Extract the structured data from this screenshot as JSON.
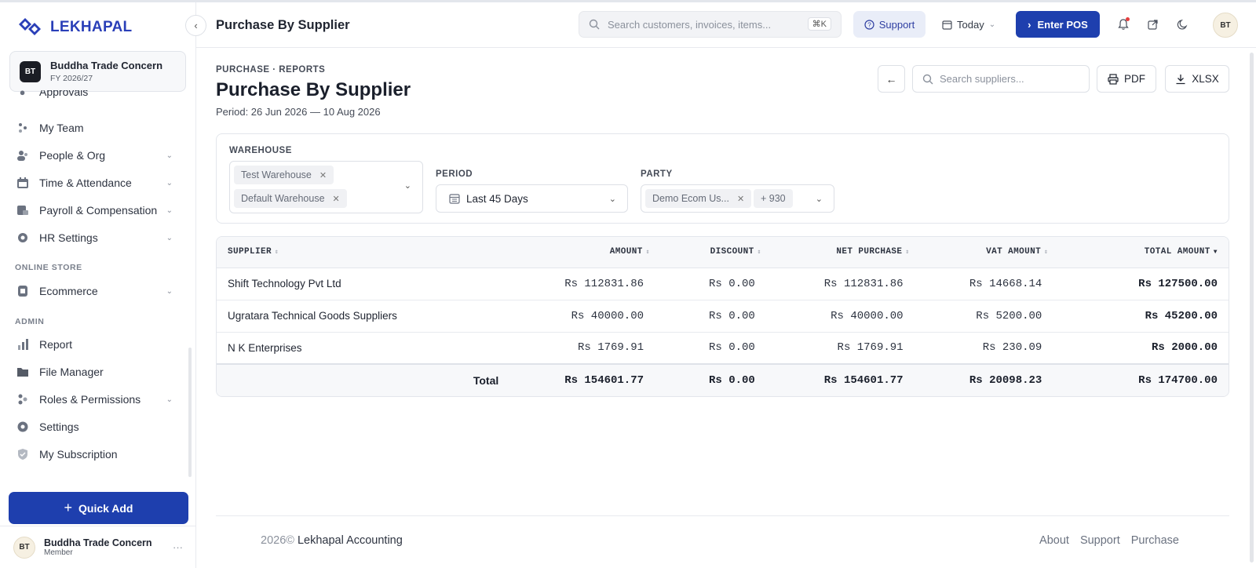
{
  "brand": {
    "name": "LEKHAPAL",
    "accent": "#1e3fae"
  },
  "company": {
    "initials": "BT",
    "name": "Buddha Trade Concern",
    "fy": "FY 2026/27"
  },
  "sidebar": {
    "partial_item": "Approvals",
    "items": [
      {
        "label": "My Team",
        "icon": "team-icon",
        "expandable": false
      },
      {
        "label": "People & Org",
        "icon": "people-icon",
        "expandable": true
      },
      {
        "label": "Time & Attendance",
        "icon": "calendar-icon",
        "expandable": true
      },
      {
        "label": "Payroll & Compensation",
        "icon": "payroll-icon",
        "expandable": true
      },
      {
        "label": "HR Settings",
        "icon": "gear-icon",
        "expandable": true
      }
    ],
    "section_online_store": "ONLINE STORE",
    "ecommerce": "Ecommerce",
    "section_admin": "ADMIN",
    "admin_items": [
      {
        "label": "Report",
        "icon": "bar-chart-icon",
        "expandable": false
      },
      {
        "label": "File Manager",
        "icon": "folder-icon",
        "expandable": false
      },
      {
        "label": "Roles & Permissions",
        "icon": "roles-icon",
        "expandable": true
      },
      {
        "label": "Settings",
        "icon": "settings-icon",
        "expandable": false
      },
      {
        "label": "My Subscription",
        "icon": "shield-icon",
        "expandable": false
      }
    ],
    "quick_add": "Quick Add",
    "user": {
      "initials": "BT",
      "name": "Buddha Trade Concern",
      "role": "Member"
    }
  },
  "topbar": {
    "title": "Purchase By Supplier",
    "search_placeholder": "Search customers, invoices, items...",
    "shortcut": "⌘K",
    "support": "Support",
    "date_filter": "Today",
    "enter_pos": "Enter POS",
    "avatar": "BT"
  },
  "page": {
    "breadcrumb": "PURCHASE · REPORTS",
    "title": "Purchase By Supplier",
    "period": "Period: 26 Jun 2026 — 10 Aug 2026",
    "supplier_search_placeholder": "Search suppliers...",
    "pdf": "PDF",
    "xlsx": "XLSX"
  },
  "filters": {
    "warehouse_label": "WAREHOUSE",
    "warehouses": [
      "Test Warehouse",
      "Default Warehouse"
    ],
    "period_label": "PERIOD",
    "period_value": "Last 45 Days",
    "party_label": "PARTY",
    "party_value": "Demo Ecom Us...",
    "party_more": "+ 930"
  },
  "table": {
    "columns": [
      "SUPPLIER",
      "AMOUNT",
      "DISCOUNT",
      "NET PURCHASE",
      "VAT AMOUNT",
      "TOTAL AMOUNT"
    ],
    "rows": [
      {
        "supplier": "Shift Technology Pvt Ltd",
        "amount": "Rs 112831.86",
        "discount": "Rs 0.00",
        "net": "Rs 112831.86",
        "vat": "Rs 14668.14",
        "total": "Rs 127500.00"
      },
      {
        "supplier": "Ugratara Technical Goods Suppliers",
        "amount": "Rs 40000.00",
        "discount": "Rs 0.00",
        "net": "Rs 40000.00",
        "vat": "Rs 5200.00",
        "total": "Rs 45200.00"
      },
      {
        "supplier": "N K Enterprises",
        "amount": "Rs 1769.91",
        "discount": "Rs 0.00",
        "net": "Rs 1769.91",
        "vat": "Rs 230.09",
        "total": "Rs 2000.00"
      }
    ],
    "totals": {
      "label": "Total",
      "amount": "Rs 154601.77",
      "discount": "Rs 0.00",
      "net": "Rs 154601.77",
      "vat": "Rs 20098.23",
      "total": "Rs 174700.00"
    }
  },
  "footer": {
    "year": "2026©",
    "company": "Lekhapal Accounting",
    "links": [
      "About",
      "Support",
      "Purchase"
    ]
  }
}
